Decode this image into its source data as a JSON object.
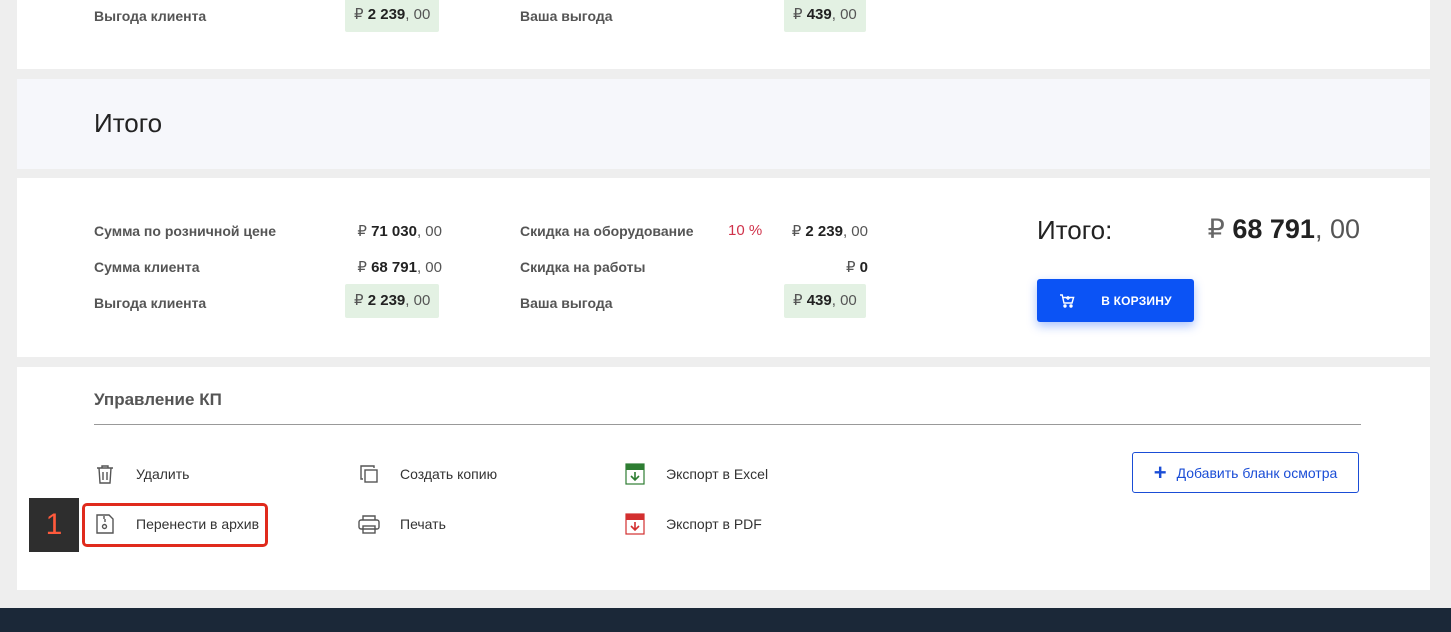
{
  "top_row": {
    "client_benefit_label": "Выгода клиента",
    "client_benefit": {
      "cur": "₽",
      "int": "2 239",
      "dec": ", 00"
    },
    "your_benefit_label": "Ваша выгода",
    "your_benefit": {
      "cur": "₽",
      "int": "439",
      "dec": ", 00"
    }
  },
  "itogo_section": {
    "title": "Итого"
  },
  "summary": {
    "retail_sum_label": "Сумма по розничной цене",
    "retail_sum": {
      "cur": "₽",
      "int": "71 030",
      "dec": ", 00"
    },
    "client_sum_label": "Сумма клиента",
    "client_sum": {
      "cur": "₽",
      "int": "68 791",
      "dec": ", 00"
    },
    "client_benefit_label": "Выгода клиента",
    "client_benefit": {
      "cur": "₽",
      "int": "2 239",
      "dec": ", 00"
    },
    "equipment_discount_label": "Скидка на оборудование",
    "equipment_discount_pct": "10 %",
    "equipment_discount": {
      "cur": "₽",
      "int": "2 239",
      "dec": ", 00"
    },
    "works_discount_label": "Скидка на работы",
    "works_discount": {
      "cur": "₽",
      "int": "0"
    },
    "your_benefit_label": "Ваша выгода",
    "your_benefit": {
      "cur": "₽",
      "int": "439",
      "dec": ", 00"
    },
    "total_label": "Итого:",
    "total": {
      "cur": "₽",
      "int": "68 791",
      "dec": ", 00"
    },
    "cart_button_label": "В КОРЗИНУ"
  },
  "manage": {
    "title": "Управление КП",
    "actions": {
      "delete": "Удалить",
      "archive": "Перенести в архив",
      "copy": "Создать копию",
      "print": "Печать",
      "export_excel": "Экспорт в Excel",
      "export_pdf": "Экспорт в PDF"
    },
    "add_inspection_label": "Добавить бланк осмотра"
  },
  "annotation": {
    "step_number": "1"
  },
  "colors": {
    "accent_blue": "#0b53f5",
    "discount_red": "#d0334b",
    "highlight_red": "#e02a1c",
    "benefit_green_bg": "#e3f1e3"
  }
}
